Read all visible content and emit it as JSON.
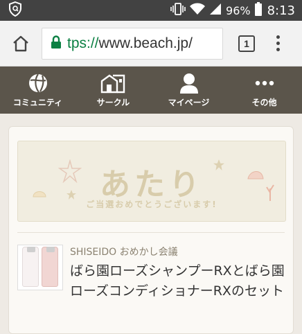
{
  "status_bar": {
    "battery": "96%",
    "time": "8:13"
  },
  "browser": {
    "url_scheme": "tps://",
    "url_host": "www.beach.jp/",
    "tab_count": "1"
  },
  "nav": {
    "items": [
      {
        "label": "コミュニティ",
        "icon": "community-ball-icon"
      },
      {
        "label": "サークル",
        "icon": "circle-houses-icon"
      },
      {
        "label": "マイページ",
        "icon": "person-icon"
      },
      {
        "label": "その他",
        "icon": "more-dots-icon"
      }
    ]
  },
  "banner": {
    "title": "あたり",
    "subtitle": "ご当選おめでとうございます!"
  },
  "product": {
    "brand": "SHISEIDO おめかし会議",
    "title": "ばら園ローズシャンプーRXとばら園ローズコンディショナーRXのセット"
  }
}
